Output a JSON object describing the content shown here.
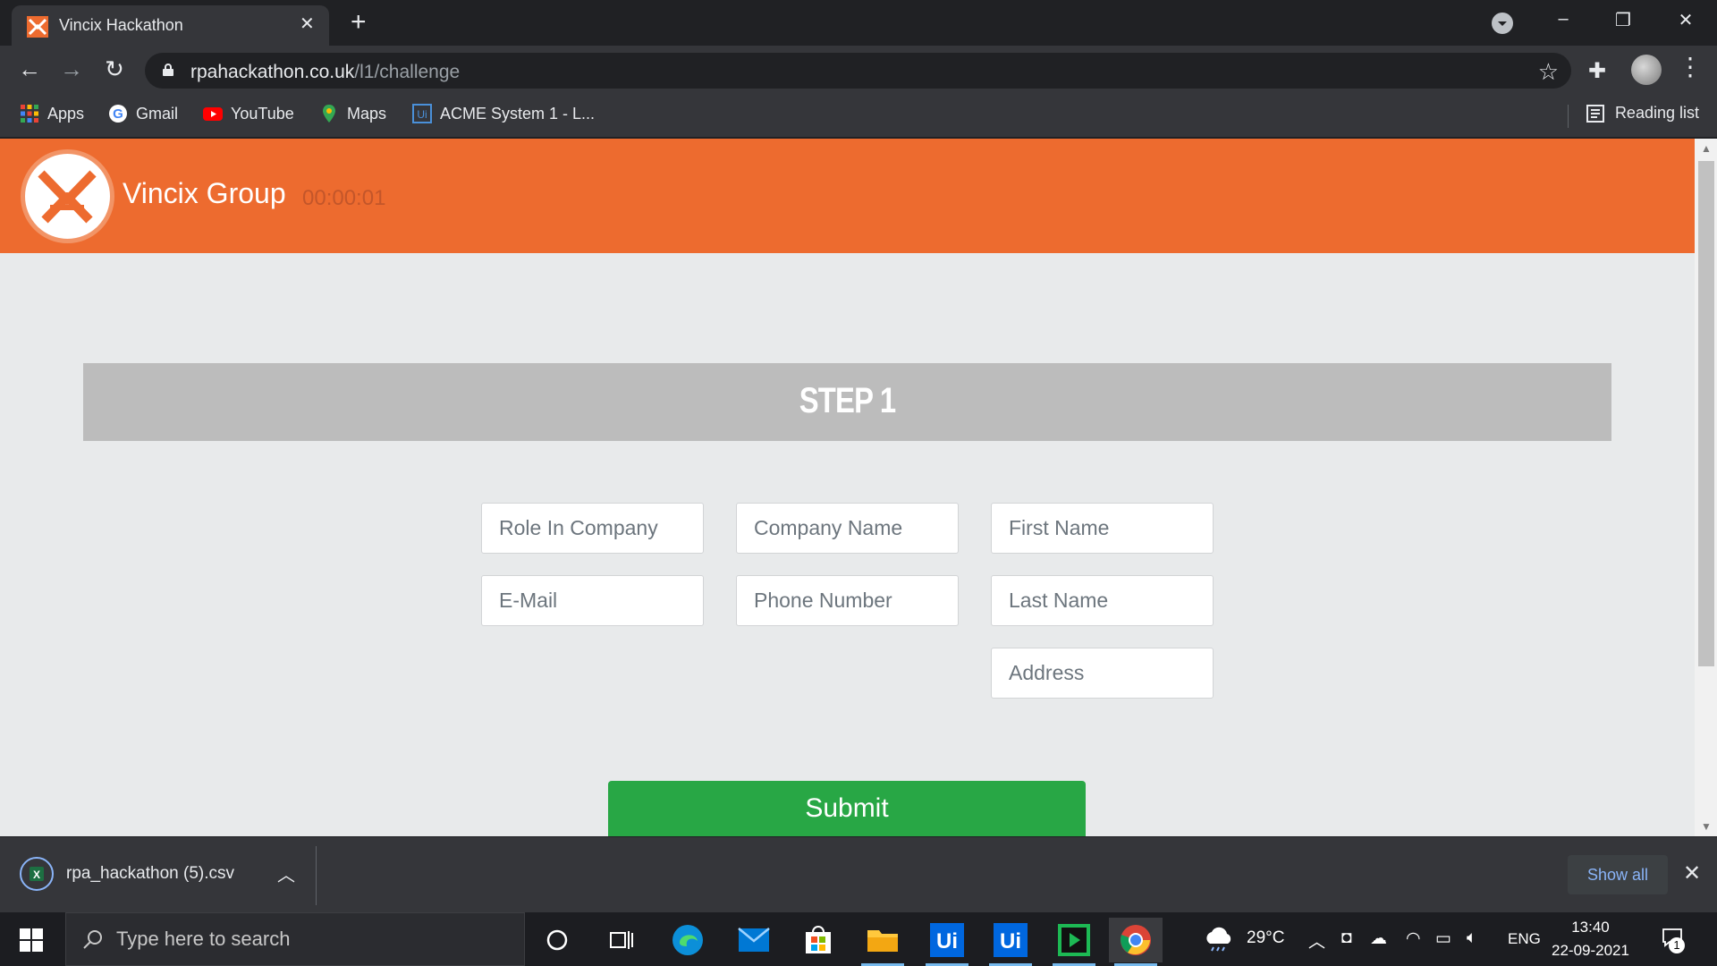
{
  "browser": {
    "tab_title": "Vincix Hackathon",
    "tab_close": "✕",
    "new_tab": "+",
    "url_host": "rpahackathon.co.uk",
    "url_path": "/l1/challenge",
    "window_controls": {
      "minimize": "–",
      "restore": "❐",
      "close": "✕"
    }
  },
  "bookmarks": [
    {
      "label": "Apps",
      "icon": "apps-grid-icon"
    },
    {
      "label": "Gmail",
      "icon": "google-icon"
    },
    {
      "label": "YouTube",
      "icon": "youtube-icon"
    },
    {
      "label": "Maps",
      "icon": "maps-pin-icon"
    },
    {
      "label": "ACME System 1 - L...",
      "icon": "uipath-icon"
    }
  ],
  "reading_list": "Reading list",
  "site": {
    "brand": "Vincix Group",
    "timer": "00:00:01",
    "step_title": "STEP 1",
    "fields": {
      "role": "Role In Company",
      "company": "Company Name",
      "first_name": "First Name",
      "email": "E-Mail",
      "phone": "Phone Number",
      "last_name": "Last Name",
      "address": "Address"
    },
    "submit_label": "Submit",
    "colors": {
      "header": "#ed6b2f",
      "submit": "#28a745",
      "step_bar": "#bcbcbc",
      "page_bg": "#e8eaeb"
    }
  },
  "download": {
    "filename": "rpa_hackathon (5).csv",
    "show_all": "Show all",
    "close": "✕"
  },
  "taskbar": {
    "search_placeholder": "Type here to search",
    "weather_temp": "29°C",
    "language": "ENG",
    "time": "13:40",
    "date": "22-09-2021",
    "notification_count": "1"
  }
}
